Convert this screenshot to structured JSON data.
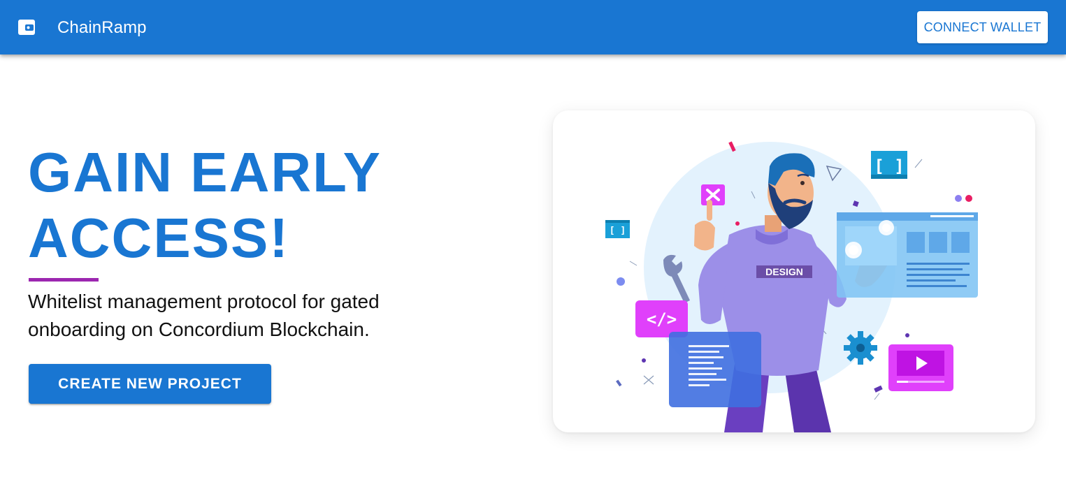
{
  "header": {
    "brand": "ChainRamp",
    "logo_icon": "wallet-icon",
    "connect_label": "CONNECT WALLET"
  },
  "hero": {
    "title": "GAIN EARLY ACCESS!",
    "subtitle": "Whitelist management protocol for gated onboarding on Concordium Blockchain.",
    "cta_label": "CREATE NEW PROJECT"
  },
  "illustration": {
    "shirt_text": "DESIGN",
    "code_tag": "</>",
    "brackets_large": "[ ]",
    "brackets_small": "[ ]"
  },
  "colors": {
    "primary": "#1976d2",
    "accent": "#9c27b0",
    "text": "#111111"
  }
}
